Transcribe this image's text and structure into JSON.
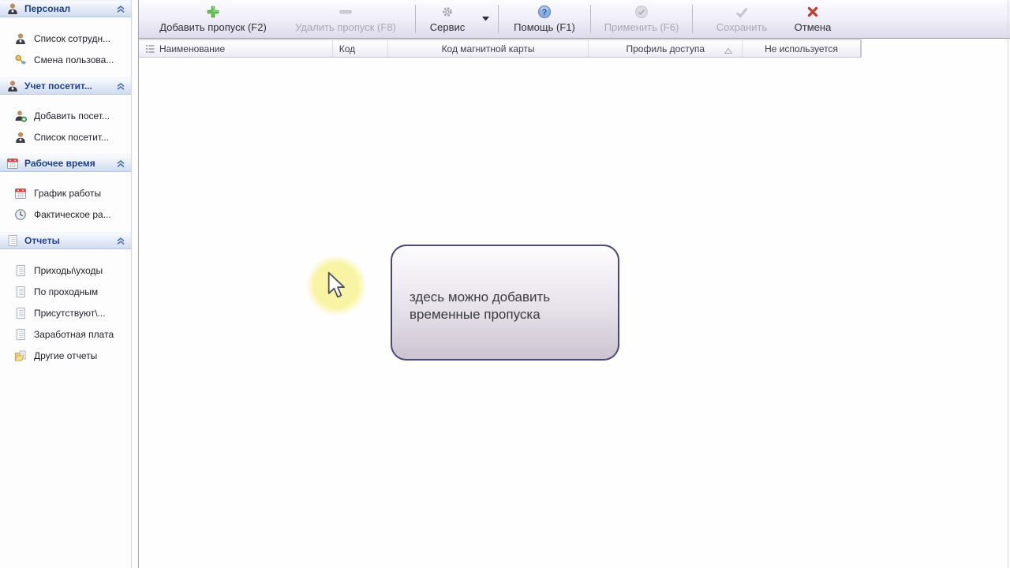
{
  "sidebar": {
    "sections": [
      {
        "title": "Персонал",
        "icon": "person",
        "items": [
          {
            "label": "Список сотрудн...",
            "icon": "person"
          },
          {
            "label": "Смена пользова...",
            "icon": "key"
          }
        ]
      },
      {
        "title": "Учет посетит...",
        "icon": "person",
        "items": [
          {
            "label": "Добавить посет...",
            "icon": "person-add"
          },
          {
            "label": "Список посетит...",
            "icon": "person"
          }
        ]
      },
      {
        "title": "Рабочее время",
        "icon": "calendar",
        "items": [
          {
            "label": "График работы",
            "icon": "calendar"
          },
          {
            "label": "Фактическое ра...",
            "icon": "clock"
          }
        ]
      },
      {
        "title": "Отчеты",
        "icon": "report",
        "items": [
          {
            "label": "Приходы\\уходы",
            "icon": "report"
          },
          {
            "label": "По проходным",
            "icon": "report"
          },
          {
            "label": "Присутствуют\\...",
            "icon": "report"
          },
          {
            "label": "Заработная плата",
            "icon": "report"
          },
          {
            "label": "Другие отчеты",
            "icon": "folder-report"
          }
        ]
      }
    ]
  },
  "toolbar": {
    "buttons": [
      {
        "label": "Добавить пропуск (F2)",
        "icon": "add-pass-icon",
        "enabled": true
      },
      {
        "label": "Удалить пропуск (F8)",
        "icon": "remove-pass-icon",
        "enabled": false
      },
      {
        "label": "Сервис",
        "icon": "gear-icon",
        "enabled": true,
        "has_dropdown": true
      },
      {
        "label": "Помощь (F1)",
        "icon": "help-icon",
        "enabled": true
      },
      {
        "label": "Применить (F6)",
        "icon": "apply-icon",
        "enabled": false
      },
      {
        "label": "Сохранить",
        "icon": "save-icon",
        "enabled": false
      },
      {
        "label": "Отмена",
        "icon": "cancel-icon",
        "enabled": true
      }
    ]
  },
  "table": {
    "columns": [
      {
        "label": "Наименование"
      },
      {
        "label": "Код"
      },
      {
        "label": "Код магнитной карты"
      },
      {
        "label": "Профиль доступа",
        "sorted": "asc"
      },
      {
        "label": "Не используется"
      }
    ],
    "rows": []
  },
  "callout": {
    "line1": "здесь можно добавить",
    "line2": "временные пропуска"
  },
  "colors": {
    "section_header_text": "#1d4090",
    "toolbar_border": "#96939e",
    "callout_border": "#4a4878",
    "highlight_yellow": "#f8f4a0",
    "add_green": "#68c455",
    "cancel_red": "#c13b33",
    "help_blue": "#7ea7e0"
  }
}
